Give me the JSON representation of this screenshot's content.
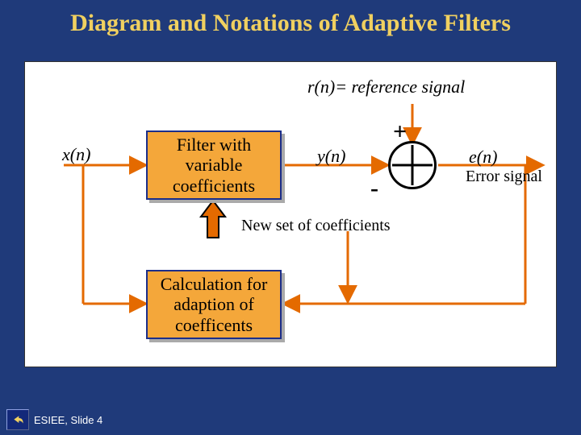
{
  "title": "Diagram and Notations of Adaptive Filters",
  "signals": {
    "input": "x(n)",
    "reference_full": "r(n)= reference signal",
    "output": "y(n)",
    "error": "e(n)",
    "error_sub": "Error signal"
  },
  "blocks": {
    "filter": "Filter with variable coefficients",
    "calc": "Calculation for adaption of coefficents",
    "new_coeff": "New set of coefficients"
  },
  "summing": {
    "plus": "+",
    "minus": "-"
  },
  "footer": {
    "slide": "ESIEE, Slide 4"
  }
}
